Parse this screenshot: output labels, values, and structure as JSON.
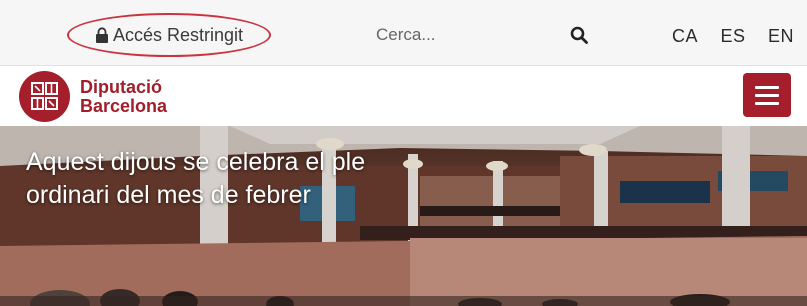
{
  "topbar": {
    "restricted_label": "Accés Restringit",
    "search_placeholder": "Cerca...",
    "languages": [
      "CA",
      "ES",
      "EN"
    ]
  },
  "header": {
    "brand_line1": "Diputació",
    "brand_line2": "Barcelona"
  },
  "hero": {
    "headline": "Aquest dijous se celebra el ple ordinari del mes de febrer"
  },
  "colors": {
    "brand": "#a51e2b",
    "highlight_ring": "#c9343f"
  }
}
